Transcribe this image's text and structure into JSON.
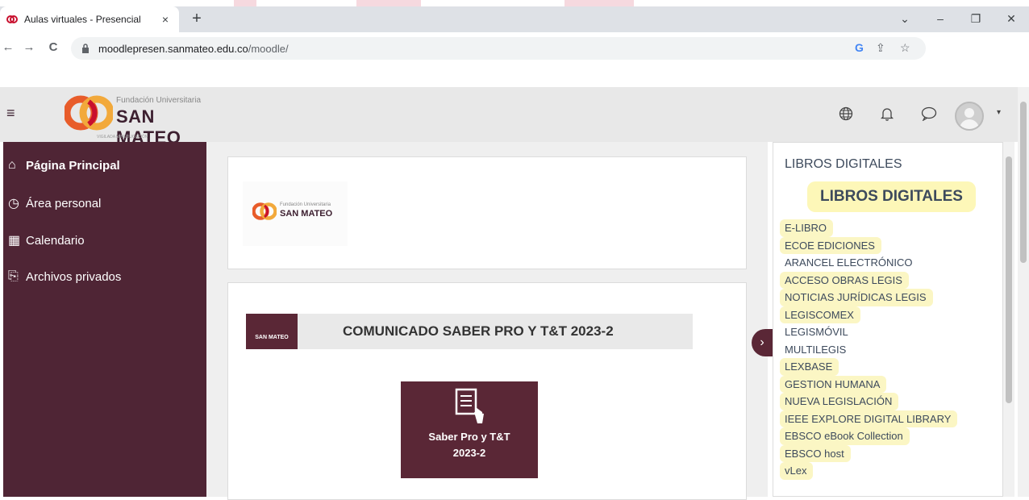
{
  "browser": {
    "tab_title": "Aulas virtuales - Presencial",
    "tab_close": "×",
    "new_tab": "+",
    "window": {
      "minimize": "–",
      "restore": "❐",
      "close": "✕",
      "tabs_menu": "⌄"
    },
    "url_host": "moodlepresen.sanmateo.edu.co",
    "url_path": "/moodle/",
    "nav": {
      "back": "←",
      "forward": "→",
      "reload": "C"
    },
    "omnibox_icons": {
      "google": "G",
      "share": "⇪",
      "star": "☆"
    }
  },
  "header": {
    "menu_icon": "≡",
    "brand_small": "Fundación Universitaria",
    "brand_big": "SAN MATEO",
    "brand_tag": "VIGILADA MINEDUCACIÓN",
    "icons": {
      "language": "globe-icon",
      "notifications": "bell-icon",
      "messages": "chat-icon"
    },
    "caret": "▾"
  },
  "sidebar": {
    "items": [
      {
        "label": "Página Principal",
        "icon": "⌂"
      },
      {
        "label": "Área personal",
        "icon": "◷"
      },
      {
        "label": "Calendario",
        "icon": "▦"
      },
      {
        "label": "Archivos privados",
        "icon": "⎘"
      }
    ]
  },
  "main": {
    "logo_small_line1": "Fundación Universitaria",
    "logo_small_line2": "SAN MATEO",
    "banner_logo": "SAN MATEO",
    "banner_text": "COMUNICADO SABER PRO Y T&T 2023-2",
    "tile_line1": "Saber Pro y T&T",
    "tile_line2": "2023-2",
    "drawer_icon": "›"
  },
  "block": {
    "title": "LIBROS DIGITALES",
    "heading": "LIBROS DIGITALES",
    "links": [
      {
        "label": "E-LIBRO",
        "highlight": true
      },
      {
        "label": "ECOE EDICIONES",
        "highlight": true
      },
      {
        "label": "ARANCEL ELECTRÓNICO",
        "highlight": false
      },
      {
        "label": "ACCESO OBRAS LEGIS",
        "highlight": true
      },
      {
        "label": "NOTICIAS JURÍDICAS LEGIS",
        "highlight": true
      },
      {
        "label": "LEGISCOMEX",
        "highlight": true
      },
      {
        "label": "LEGISMÓVIL",
        "highlight": false
      },
      {
        "label": "MULTILEGIS",
        "highlight": false
      },
      {
        "label": "LEXBASE",
        "highlight": true
      },
      {
        "label": "GESTION HUMANA",
        "highlight": true
      },
      {
        "label": "NUEVA LEGISLACIÓN",
        "highlight": true
      },
      {
        "label": "IEEE EXPLORE DIGITAL LIBRARY",
        "highlight": true
      },
      {
        "label": "EBSCO eBook Collection",
        "highlight": true
      },
      {
        "label": "EBSCO host",
        "highlight": true
      },
      {
        "label": "vLex",
        "highlight": true
      }
    ]
  },
  "colors": {
    "brand": "#5a2736",
    "sidebar": "#4f2535",
    "highlight": "#fbf6c4"
  }
}
